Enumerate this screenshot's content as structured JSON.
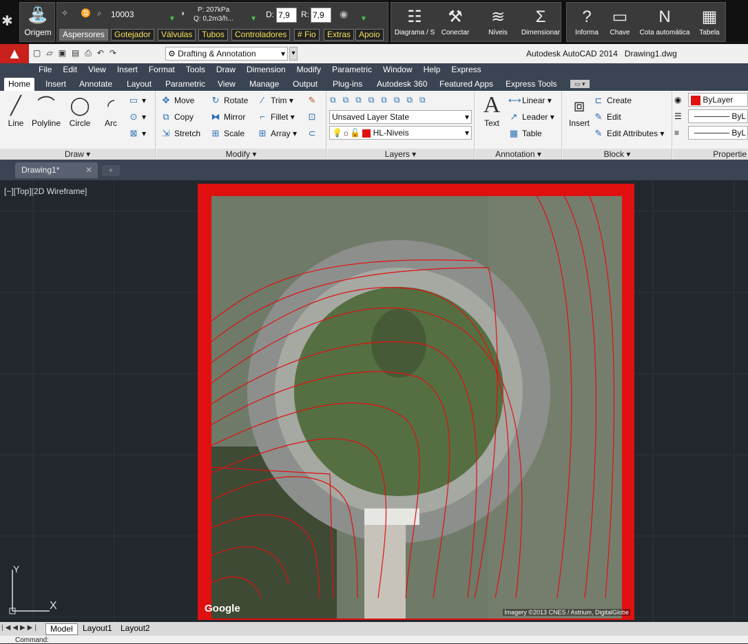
{
  "plugin": {
    "origem": "Origem",
    "code": "10003",
    "pressure": "P: 207kPa",
    "flow": "Q: 0,2m3/h...",
    "d_label": "D:",
    "d_value": "7,9",
    "r_label": "R:",
    "r_value": "7,9",
    "tabs": [
      "Aspersores",
      "Gotejador",
      "Válvulas",
      "Tubos",
      "Controladores",
      "# Fio",
      "Extras",
      "Apoio"
    ],
    "buttons": [
      "Diagrama / S",
      "Conectar",
      "Níveis",
      "Dimensionar",
      "Informa",
      "Chave",
      "Cota automática",
      "Tabela"
    ]
  },
  "title": {
    "workspace": "Drafting & Annotation",
    "app": "Autodesk AutoCAD 2014",
    "file": "Drawing1.dwg"
  },
  "menu": [
    "File",
    "Edit",
    "View",
    "Insert",
    "Format",
    "Tools",
    "Draw",
    "Dimension",
    "Modify",
    "Parametric",
    "Window",
    "Help",
    "Express"
  ],
  "ribbon_tabs": [
    "Home",
    "Insert",
    "Annotate",
    "Layout",
    "Parametric",
    "View",
    "Manage",
    "Output",
    "Plug-ins",
    "Autodesk 360",
    "Featured Apps",
    "Express Tools"
  ],
  "draw": {
    "title": "Draw",
    "line": "Line",
    "polyline": "Polyline",
    "circle": "Circle",
    "arc": "Arc"
  },
  "modify": {
    "title": "Modify",
    "move": "Move",
    "rotate": "Rotate",
    "trim": "Trim",
    "copy": "Copy",
    "mirror": "Mirror",
    "fillet": "Fillet",
    "stretch": "Stretch",
    "scale": "Scale",
    "array": "Array"
  },
  "layers": {
    "title": "Layers",
    "state": "Unsaved Layer State",
    "layer": "HL-Niveis"
  },
  "annotation": {
    "title": "Annotation",
    "text": "Text",
    "linear": "Linear",
    "leader": "Leader",
    "table": "Table"
  },
  "block": {
    "title": "Block",
    "insert": "Insert",
    "create": "Create",
    "edit": "Edit",
    "edit_attr": "Edit Attributes"
  },
  "properties": {
    "title": "Propertie",
    "color": "ByLayer",
    "lt": "ByL",
    "lw": "ByL"
  },
  "doc_tab": "Drawing1*",
  "viewport_label": "[−][Top][2D Wireframe]",
  "map": {
    "google": "Google",
    "credit": "Imagery ©2013 CNES / Astrium, DigitalGlobe"
  },
  "ucs": {
    "x": "X",
    "y": "Y"
  },
  "layout_tabs": [
    "Model",
    "Layout1",
    "Layout2"
  ],
  "cmd": "Command:",
  "colors": {
    "contour": "#e01010",
    "accent": "#c8201a",
    "grass": "#5c7a4a"
  }
}
